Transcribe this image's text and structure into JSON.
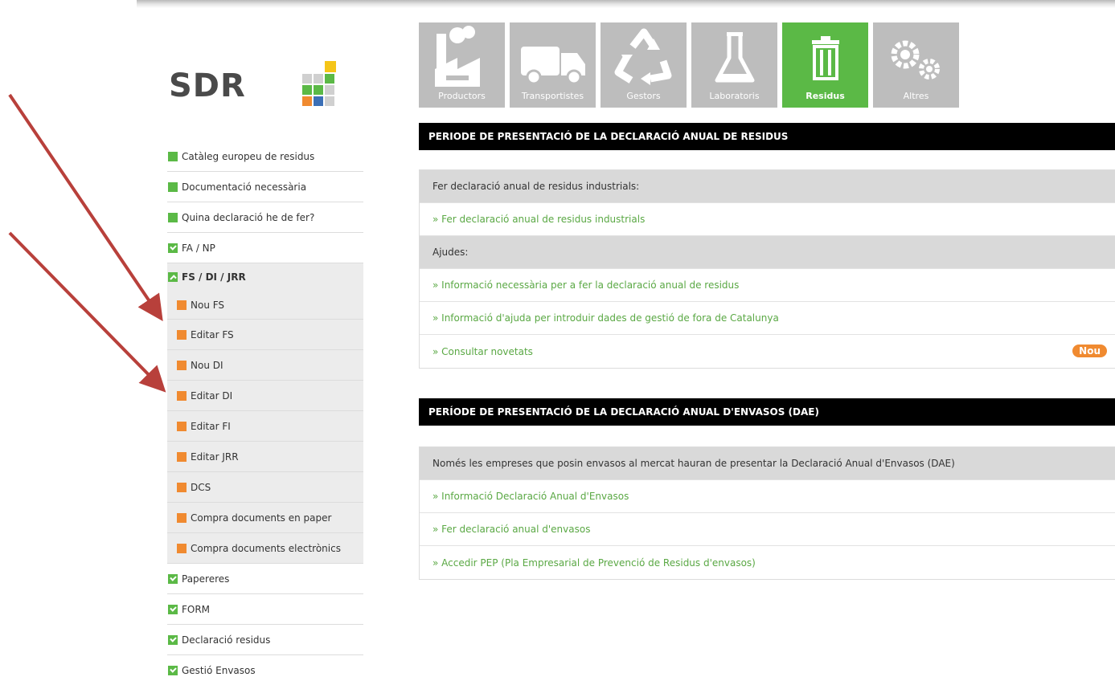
{
  "logo": {
    "text": "SDR"
  },
  "tiles": [
    {
      "label": "Productors",
      "icon": "factory-icon",
      "active": false
    },
    {
      "label": "Transportistes",
      "icon": "truck-icon",
      "active": false
    },
    {
      "label": "Gestors",
      "icon": "recycle-icon",
      "active": false
    },
    {
      "label": "Laboratoris",
      "icon": "flask-icon",
      "active": false
    },
    {
      "label": "Residus",
      "icon": "trash-icon",
      "active": true
    },
    {
      "label": "Altres",
      "icon": "gears-icon",
      "active": false
    }
  ],
  "sidebar": {
    "items": [
      {
        "label": "Catàleg europeu de residus"
      },
      {
        "label": "Documentació necessària"
      },
      {
        "label": "Quina declaració he de fer?"
      },
      {
        "label": "FA / NP"
      }
    ],
    "section": {
      "label": "FS / DI / JRR"
    },
    "sub_items": [
      {
        "label": "Nou FS"
      },
      {
        "label": "Editar FS"
      },
      {
        "label": "Nou DI"
      },
      {
        "label": "Editar DI"
      },
      {
        "label": "Editar FI"
      },
      {
        "label": "Editar JRR"
      },
      {
        "label": "DCS"
      },
      {
        "label": "Compra documents en paper"
      },
      {
        "label": "Compra documents electrònics"
      }
    ],
    "bottom_items": [
      {
        "label": "Papereres"
      },
      {
        "label": "FORM"
      },
      {
        "label": "Declaració residus"
      },
      {
        "label": "Gestió Envasos"
      }
    ]
  },
  "section1": {
    "title": "PERIODE DE PRESENTACIÓ DE LA DECLARACIÓ ANUAL DE RESIDUS",
    "header1": "Fer declaració anual de residus industrials:",
    "link1": "» Fer declaració anual de residus industrials",
    "header2": "Ajudes:",
    "link2": "» Informació necessària per a fer la declaració anual de residus",
    "link3": "» Informació d'ajuda per introduir dades de gestió de fora de Catalunya",
    "link4": "» Consultar novetats",
    "badge": "Nou"
  },
  "section2": {
    "title": "PERÍODE DE PRESENTACIÓ DE LA DECLARACIÓ ANUAL D'ENVASOS (DAE)",
    "header1": "Només les empreses que posin envasos al mercat hauran de presentar la Declaració Anual d'Envasos (DAE)",
    "link1": "» Informació Declaració Anual d'Envasos",
    "link2": "» Fer declaració anual d'envasos",
    "link3": "» Accedir PEP (Pla Empresarial de Prevenció de Residus d'envasos)"
  },
  "colors": {
    "accent_green": "#5bb946",
    "accent_orange": "#f08a30",
    "link_green": "#5aa844",
    "arrow_red": "#b8403b"
  }
}
